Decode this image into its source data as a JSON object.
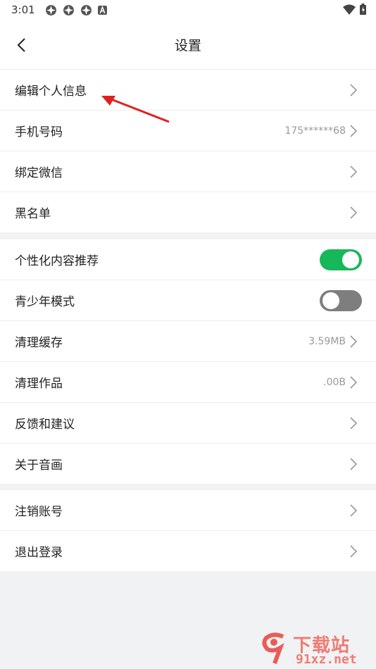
{
  "status_bar": {
    "time": "3:01"
  },
  "header": {
    "title": "设置"
  },
  "sections": [
    {
      "items": [
        {
          "label": "编辑个人信息",
          "value": ""
        },
        {
          "label": "手机号码",
          "value": "175******68"
        },
        {
          "label": "绑定微信",
          "value": ""
        },
        {
          "label": "黑名单",
          "value": ""
        }
      ]
    },
    {
      "items": [
        {
          "label": "个性化内容推荐",
          "toggle": true
        },
        {
          "label": "青少年模式",
          "toggle": false
        },
        {
          "label": "清理缓存",
          "value": "3.59MB"
        },
        {
          "label": "清理作品",
          "value": ".00B"
        },
        {
          "label": "反馈和建议",
          "value": ""
        },
        {
          "label": "关于音画",
          "value": ""
        }
      ]
    },
    {
      "items": [
        {
          "label": "注销账号",
          "value": ""
        },
        {
          "label": "退出登录",
          "value": ""
        }
      ]
    }
  ],
  "watermark": {
    "text_top": "下载站",
    "text_bottom": "91xz.net",
    "logo": "9"
  },
  "colors": {
    "toggle_on": "#16b85a",
    "toggle_off": "#7e7e7e",
    "annotation_arrow": "#e02020",
    "watermark": "#e8423c"
  }
}
